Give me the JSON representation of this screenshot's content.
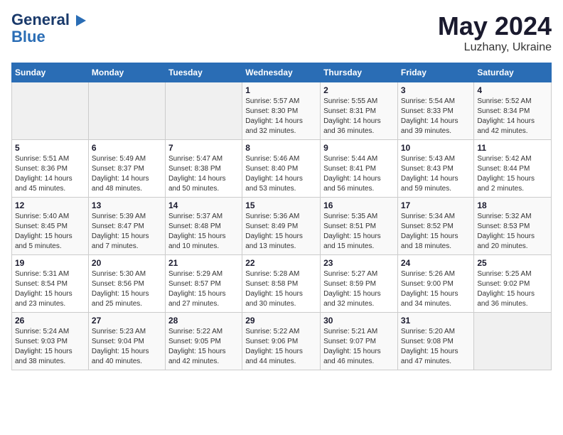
{
  "header": {
    "logo_line1": "General",
    "logo_line2": "Blue",
    "month": "May 2024",
    "location": "Luzhany, Ukraine"
  },
  "weekdays": [
    "Sunday",
    "Monday",
    "Tuesday",
    "Wednesday",
    "Thursday",
    "Friday",
    "Saturday"
  ],
  "weeks": [
    [
      {
        "day": "",
        "info": ""
      },
      {
        "day": "",
        "info": ""
      },
      {
        "day": "",
        "info": ""
      },
      {
        "day": "1",
        "info": "Sunrise: 5:57 AM\nSunset: 8:30 PM\nDaylight: 14 hours\nand 32 minutes."
      },
      {
        "day": "2",
        "info": "Sunrise: 5:55 AM\nSunset: 8:31 PM\nDaylight: 14 hours\nand 36 minutes."
      },
      {
        "day": "3",
        "info": "Sunrise: 5:54 AM\nSunset: 8:33 PM\nDaylight: 14 hours\nand 39 minutes."
      },
      {
        "day": "4",
        "info": "Sunrise: 5:52 AM\nSunset: 8:34 PM\nDaylight: 14 hours\nand 42 minutes."
      }
    ],
    [
      {
        "day": "5",
        "info": "Sunrise: 5:51 AM\nSunset: 8:36 PM\nDaylight: 14 hours\nand 45 minutes."
      },
      {
        "day": "6",
        "info": "Sunrise: 5:49 AM\nSunset: 8:37 PM\nDaylight: 14 hours\nand 48 minutes."
      },
      {
        "day": "7",
        "info": "Sunrise: 5:47 AM\nSunset: 8:38 PM\nDaylight: 14 hours\nand 50 minutes."
      },
      {
        "day": "8",
        "info": "Sunrise: 5:46 AM\nSunset: 8:40 PM\nDaylight: 14 hours\nand 53 minutes."
      },
      {
        "day": "9",
        "info": "Sunrise: 5:44 AM\nSunset: 8:41 PM\nDaylight: 14 hours\nand 56 minutes."
      },
      {
        "day": "10",
        "info": "Sunrise: 5:43 AM\nSunset: 8:43 PM\nDaylight: 14 hours\nand 59 minutes."
      },
      {
        "day": "11",
        "info": "Sunrise: 5:42 AM\nSunset: 8:44 PM\nDaylight: 15 hours\nand 2 minutes."
      }
    ],
    [
      {
        "day": "12",
        "info": "Sunrise: 5:40 AM\nSunset: 8:45 PM\nDaylight: 15 hours\nand 5 minutes."
      },
      {
        "day": "13",
        "info": "Sunrise: 5:39 AM\nSunset: 8:47 PM\nDaylight: 15 hours\nand 7 minutes."
      },
      {
        "day": "14",
        "info": "Sunrise: 5:37 AM\nSunset: 8:48 PM\nDaylight: 15 hours\nand 10 minutes."
      },
      {
        "day": "15",
        "info": "Sunrise: 5:36 AM\nSunset: 8:49 PM\nDaylight: 15 hours\nand 13 minutes."
      },
      {
        "day": "16",
        "info": "Sunrise: 5:35 AM\nSunset: 8:51 PM\nDaylight: 15 hours\nand 15 minutes."
      },
      {
        "day": "17",
        "info": "Sunrise: 5:34 AM\nSunset: 8:52 PM\nDaylight: 15 hours\nand 18 minutes."
      },
      {
        "day": "18",
        "info": "Sunrise: 5:32 AM\nSunset: 8:53 PM\nDaylight: 15 hours\nand 20 minutes."
      }
    ],
    [
      {
        "day": "19",
        "info": "Sunrise: 5:31 AM\nSunset: 8:54 PM\nDaylight: 15 hours\nand 23 minutes."
      },
      {
        "day": "20",
        "info": "Sunrise: 5:30 AM\nSunset: 8:56 PM\nDaylight: 15 hours\nand 25 minutes."
      },
      {
        "day": "21",
        "info": "Sunrise: 5:29 AM\nSunset: 8:57 PM\nDaylight: 15 hours\nand 27 minutes."
      },
      {
        "day": "22",
        "info": "Sunrise: 5:28 AM\nSunset: 8:58 PM\nDaylight: 15 hours\nand 30 minutes."
      },
      {
        "day": "23",
        "info": "Sunrise: 5:27 AM\nSunset: 8:59 PM\nDaylight: 15 hours\nand 32 minutes."
      },
      {
        "day": "24",
        "info": "Sunrise: 5:26 AM\nSunset: 9:00 PM\nDaylight: 15 hours\nand 34 minutes."
      },
      {
        "day": "25",
        "info": "Sunrise: 5:25 AM\nSunset: 9:02 PM\nDaylight: 15 hours\nand 36 minutes."
      }
    ],
    [
      {
        "day": "26",
        "info": "Sunrise: 5:24 AM\nSunset: 9:03 PM\nDaylight: 15 hours\nand 38 minutes."
      },
      {
        "day": "27",
        "info": "Sunrise: 5:23 AM\nSunset: 9:04 PM\nDaylight: 15 hours\nand 40 minutes."
      },
      {
        "day": "28",
        "info": "Sunrise: 5:22 AM\nSunset: 9:05 PM\nDaylight: 15 hours\nand 42 minutes."
      },
      {
        "day": "29",
        "info": "Sunrise: 5:22 AM\nSunset: 9:06 PM\nDaylight: 15 hours\nand 44 minutes."
      },
      {
        "day": "30",
        "info": "Sunrise: 5:21 AM\nSunset: 9:07 PM\nDaylight: 15 hours\nand 46 minutes."
      },
      {
        "day": "31",
        "info": "Sunrise: 5:20 AM\nSunset: 9:08 PM\nDaylight: 15 hours\nand 47 minutes."
      },
      {
        "day": "",
        "info": ""
      }
    ]
  ]
}
